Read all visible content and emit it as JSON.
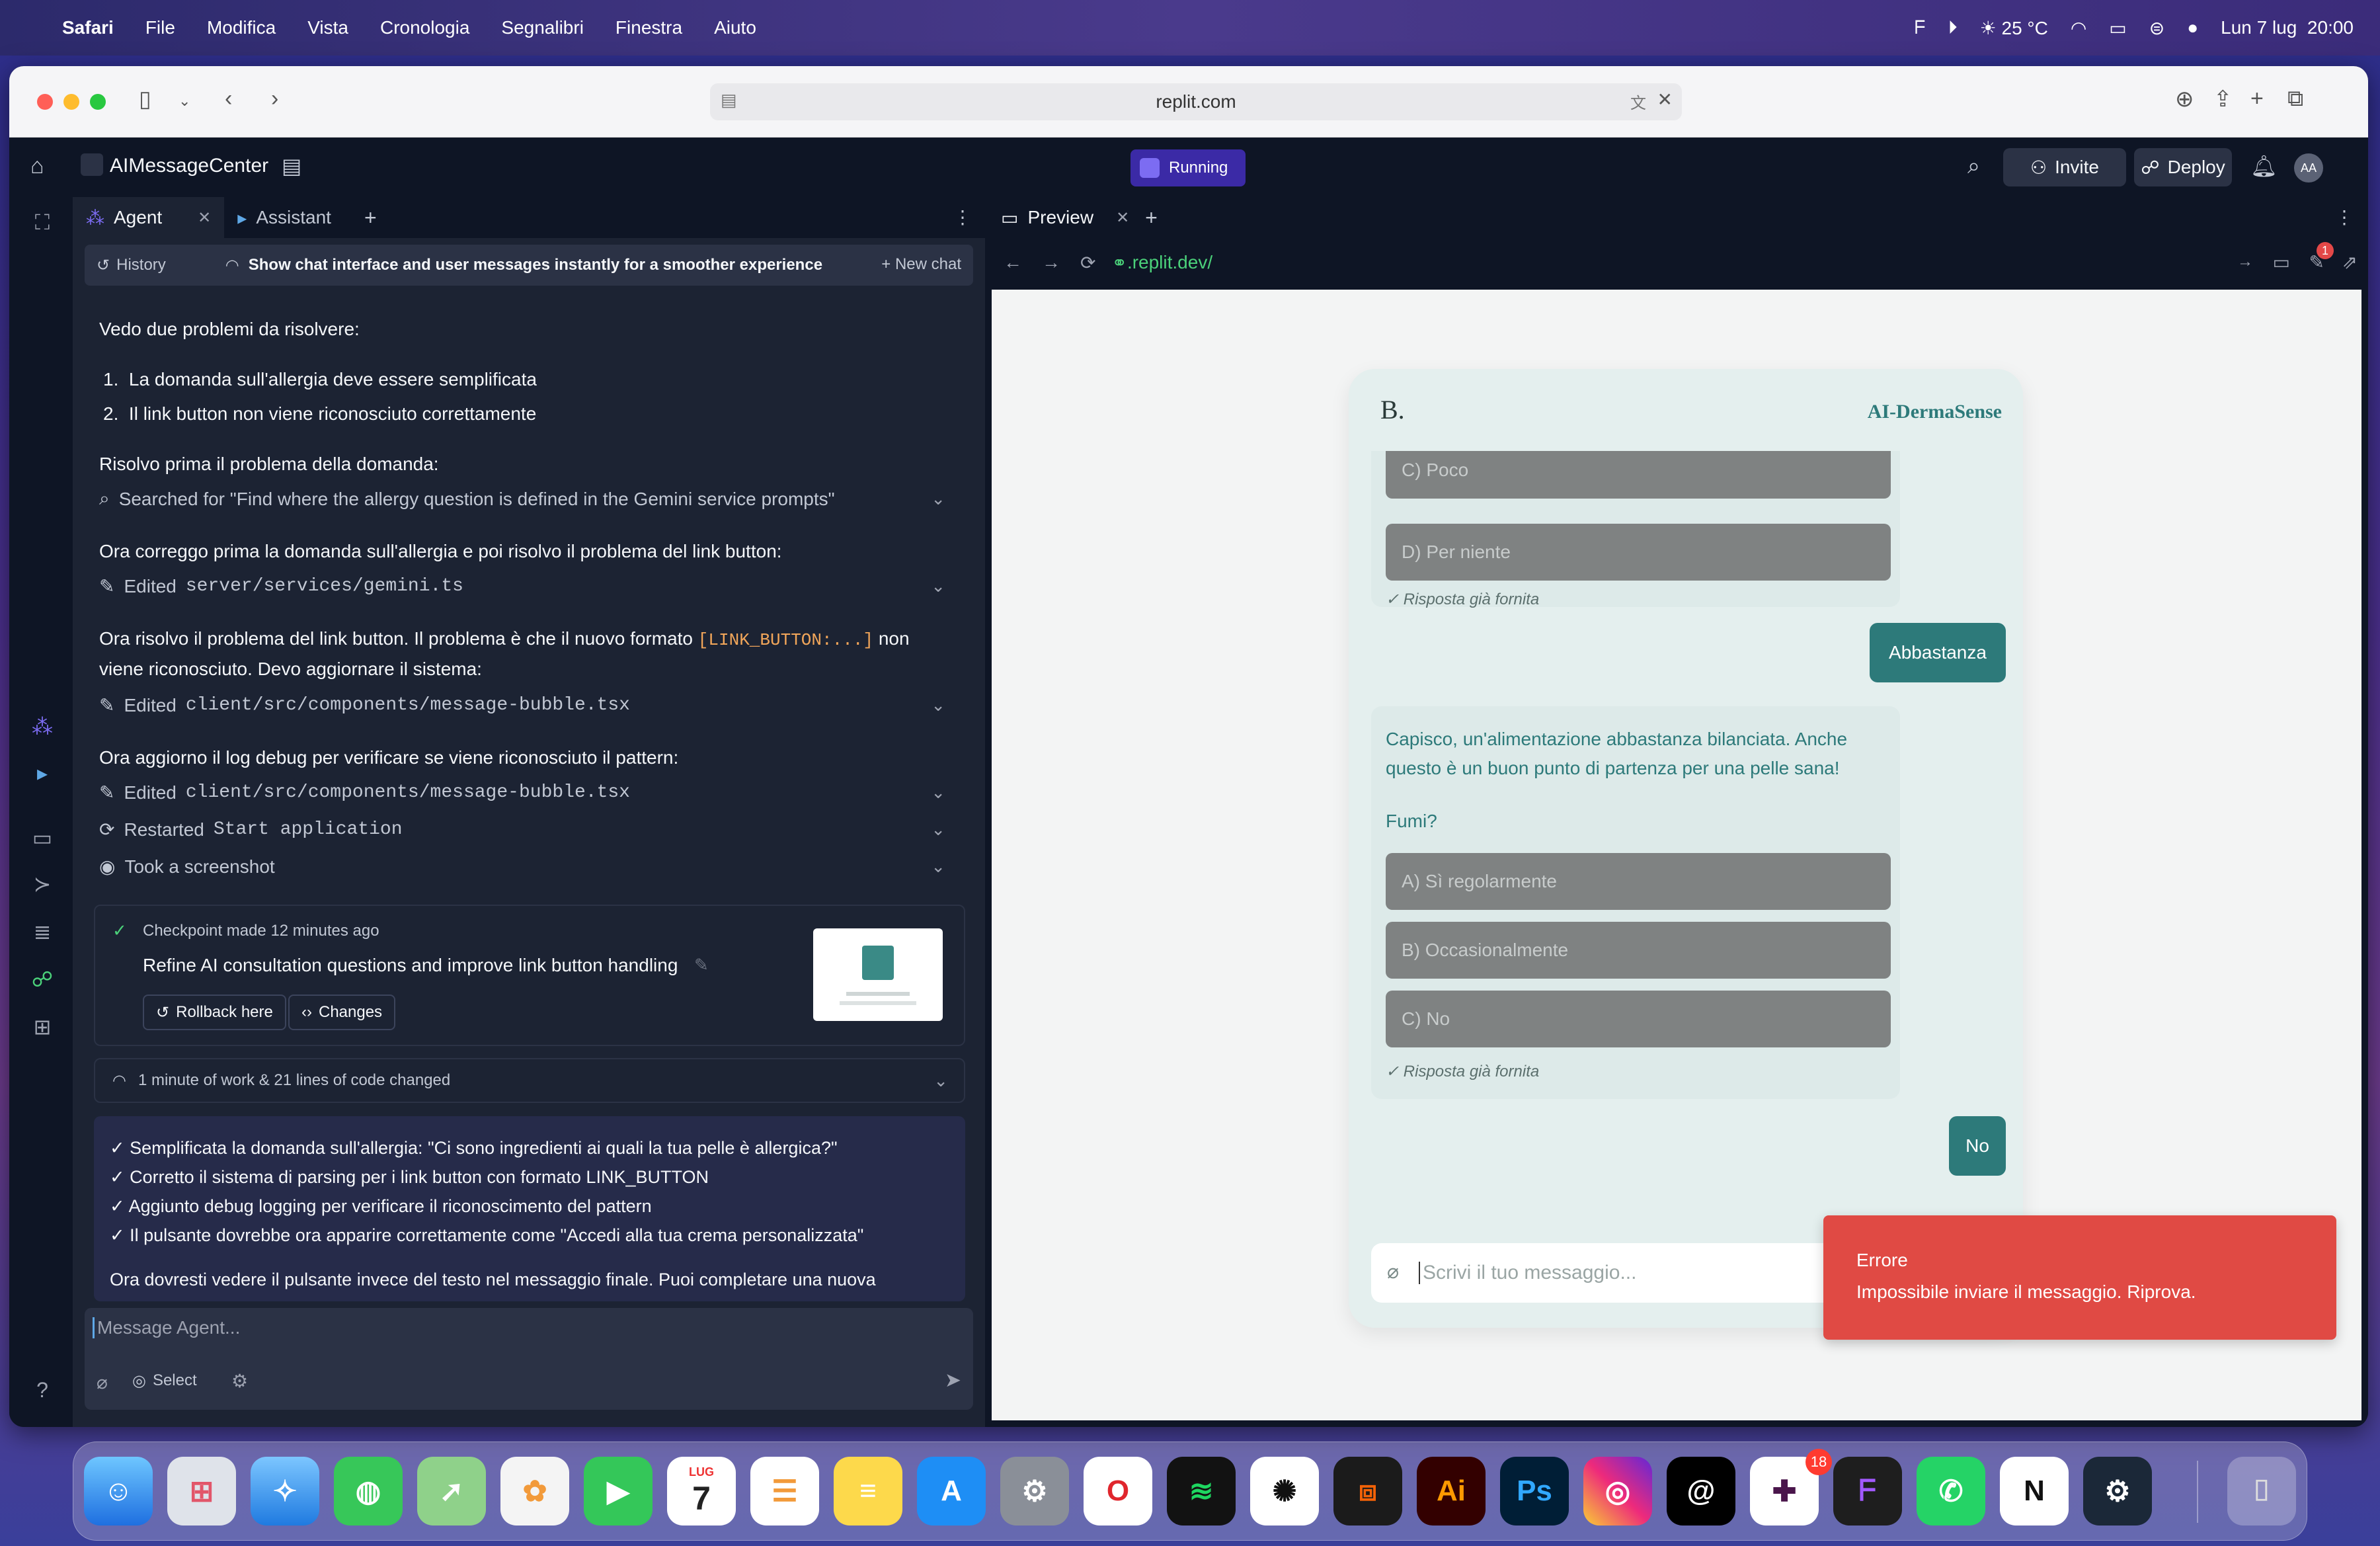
{
  "menubar": {
    "app": "Safari",
    "items": [
      "File",
      "Modifica",
      "Vista",
      "Cronologia",
      "Segnalibri",
      "Finestra",
      "Aiuto"
    ],
    "weather": "25 °C",
    "date": "Lun 7 lug",
    "time": "20:00"
  },
  "safari": {
    "url": "replit.com"
  },
  "replit": {
    "project": "AIMessageCenter",
    "status": "Running",
    "invite": "Invite",
    "deploy": "Deploy",
    "avatar": "AA"
  },
  "agent": {
    "tabs": [
      "Agent",
      "Assistant"
    ],
    "history": "History",
    "chat_title": "Show chat interface and user messages instantly for a smoother experience",
    "new_chat": "New chat",
    "intro": "Vedo due problemi da risolvere:",
    "list": [
      "La domanda sull'allergia deve essere semplificata",
      "Il link button non viene riconosciuto correttamente"
    ],
    "p1": "Risolvo prima il problema della domanda:",
    "search": "Searched for \"Find where the allergy question is defined in the Gemini service prompts\"",
    "p2": "Ora correggo prima la domanda sull'allergia e poi risolvo il problema del link button:",
    "edit1_prefix": "Edited",
    "edit1_file": "server/services/gemini.ts",
    "p3a": "Ora risolvo il problema del link button. Il problema è che il nuovo formato",
    "p3code": "[LINK_BUTTON:...]",
    "p3b": "non",
    "p3c": "viene riconosciuto. Devo aggiornare il sistema:",
    "edit2_file": "client/src/components/message-bubble.tsx",
    "p4": "Ora aggiorno il log debug per verificare se viene riconosciuto il pattern:",
    "edit3_file": "client/src/components/message-bubble.tsx",
    "restart_prefix": "Restarted",
    "restart_name": "Start application",
    "screenshot": "Took a screenshot",
    "checkpoint_time": "Checkpoint made 12 minutes ago",
    "checkpoint_desc": "Refine AI consultation questions and improve link button handling",
    "rollback": "Rollback here",
    "changes": "Changes",
    "work": "1 minute of work & 21 lines of code changed",
    "summary": [
      "✓ Semplificata la domanda sull'allergia: \"Ci sono ingredienti ai quali la tua pelle è allergica?\"",
      "✓ Corretto il sistema di parsing per i link button con formato LINK_BUTTON",
      "✓ Aggiunto debug logging per verificare il riconoscimento del pattern",
      "✓ Il pulsante dovrebbe ora apparire correttamente come \"Accedi alla tua crema personalizzata\""
    ],
    "summary_tail": "Ora dovresti vedere il pulsante invece del testo nel messaggio finale. Puoi completare una nuova",
    "input_placeholder": "Message Agent...",
    "select": "Select"
  },
  "preview": {
    "tab": "Preview",
    "url": ".replit.dev/",
    "badge": "1",
    "logo": "B.",
    "brand": "AI-DermaSense",
    "opt_partial": "C) Poco",
    "opt_d": "D) Per niente",
    "answered": "✓ Risposta già fornita",
    "user1": "Abbastanza",
    "bot_msg": "Capisco, un'alimentazione abbastanza bilanciata. Anche questo è un buon punto di partenza per una pelle sana!",
    "bot_q": "Fumi?",
    "opts": [
      "A) Sì regolarmente",
      "B) Occasionalmente",
      "C) No"
    ],
    "answered2": "✓ Risposta già fornita",
    "user2": "No",
    "input_placeholder": "Scrivi il tuo messaggio...",
    "toast_title": "Errore",
    "toast_msg": "Impossibile inviare il messaggio. Riprova."
  },
  "dock": {
    "calendar_month": "LUG",
    "calendar_day": "7",
    "slack_badge": "18"
  }
}
